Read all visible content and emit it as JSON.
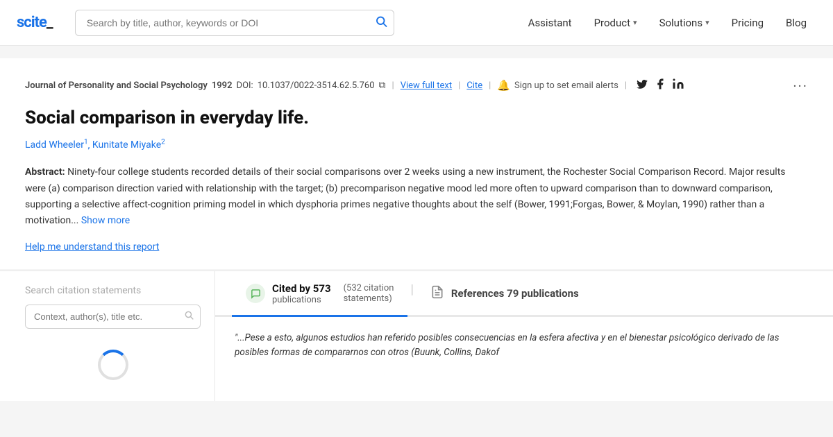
{
  "nav": {
    "logo": "scite_",
    "search_placeholder": "Search by title, author, keywords or DOI",
    "links": [
      {
        "label": "Assistant",
        "has_dropdown": false
      },
      {
        "label": "Product",
        "has_dropdown": true
      },
      {
        "label": "Solutions",
        "has_dropdown": true
      },
      {
        "label": "Pricing",
        "has_dropdown": false
      },
      {
        "label": "Blog",
        "has_dropdown": false
      }
    ]
  },
  "article": {
    "journal": "Journal of Personality and Social Psychology",
    "year": "1992",
    "doi_label": "DOI:",
    "doi": "10.1037/0022-3514.62.5.760",
    "view_full_text": "View full text",
    "cite": "Cite",
    "alert_text": "Sign up to set email alerts",
    "title": "Social comparison in everyday life.",
    "authors": [
      {
        "name": "Ladd Wheeler",
        "superscript": "1"
      },
      {
        "name": "Kunitate Miyake",
        "superscript": "2"
      }
    ],
    "abstract_label": "Abstract:",
    "abstract_text": "Ninety-four college students recorded details of their social comparisons over 2 weeks using a new instrument, the Rochester Social Comparison Record. Major results were (a) comparison direction varied with relationship with the target; (b) precomparison negative mood led more often to upward comparison than to downward comparison, supporting a selective affect-cognition priming model in which dysphoria primes negative thoughts about the self (Bower, 1991;Forgas, Bower, & Moylan, 1990) rather than a motivation...",
    "show_more": "Show more",
    "help_link": "Help me understand this report"
  },
  "search_citations": {
    "label": "Search citation statements",
    "placeholder": "Context, author(s), title etc."
  },
  "tabs": [
    {
      "id": "cited-by",
      "icon_type": "bubble",
      "label_main": "Cited by 573",
      "label_sub": "publications",
      "sub_right": "(532 citation",
      "sub_right2": "statements)",
      "active": true
    },
    {
      "id": "references",
      "icon_type": "doc",
      "label_main": "References 79 publications",
      "active": false
    }
  ],
  "citation_quote": "\"...Pese a esto, algunos estudios han referido posibles consecuencias en la esfera afectiva y en el bienestar psicológico derivado de las posibles formas de compararnos con otros (Buunk, Collins, Dakof"
}
